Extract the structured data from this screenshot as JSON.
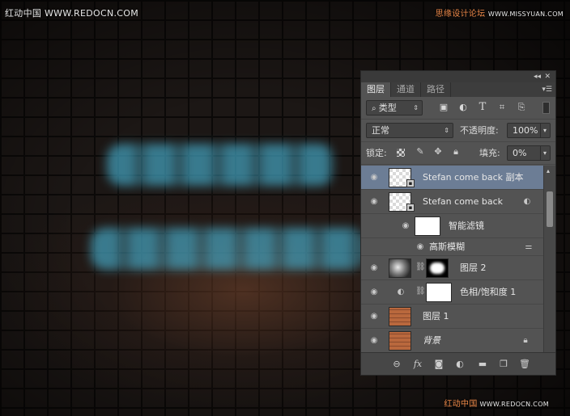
{
  "watermarks": {
    "top_left": "红动中国 WWW.REDOCN.COM",
    "top_right_cn": "思缘设计论坛",
    "top_right_url": "WWW.MISSYUAN.COM",
    "bottom_right_prefix": "红动中国",
    "bottom_right_url": "WWW.REDOCN.COM"
  },
  "panel": {
    "tabs": [
      "图层",
      "通道",
      "路径"
    ],
    "active_tab": "图层",
    "filter_kind": "类型",
    "blend_mode": "正常",
    "opacity_label": "不透明度:",
    "opacity_value": "100%",
    "lock_label": "锁定:",
    "fill_label": "填充:",
    "fill_value": "0%",
    "layers": [
      {
        "name": "Stefan  come back 副本",
        "type": "smart",
        "selected": true
      },
      {
        "name": "Stefan  come back",
        "type": "smart",
        "selected": false
      },
      {
        "name": "智能滤镜",
        "type": "smart-filter-header",
        "selected": false
      },
      {
        "name": "高斯模糊",
        "type": "filter",
        "selected": false
      },
      {
        "name": "图层 2",
        "type": "masked",
        "selected": false
      },
      {
        "name": "色相/饱和度 1",
        "type": "adjustment",
        "selected": false
      },
      {
        "name": "图层 1",
        "type": "pixel",
        "selected": false
      },
      {
        "name": "背景",
        "type": "background",
        "selected": false
      }
    ]
  },
  "icons": {
    "eye": "eye-icon",
    "lock": "lock-icon",
    "link": "link-icon",
    "fx": "fx-icon",
    "mask": "add-mask-icon",
    "adjust": "new-adjustment-icon",
    "folder": "new-group-icon",
    "new_layer": "new-layer-icon",
    "trash": "delete-layer-icon"
  },
  "colors": {
    "panel_bg": "#535353",
    "selected_row": "#6c7d95",
    "glow": "#46aac8"
  }
}
